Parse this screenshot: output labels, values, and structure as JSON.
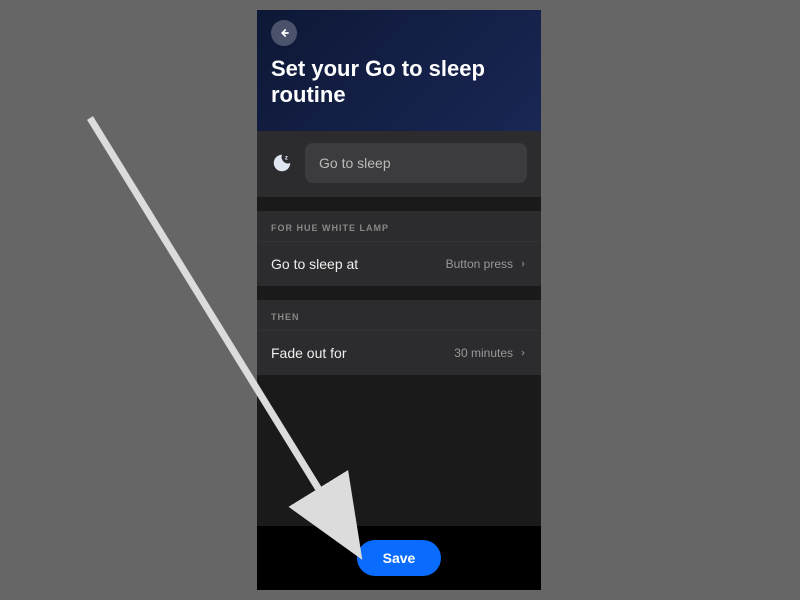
{
  "header": {
    "title": "Set your Go to sleep routine"
  },
  "routine": {
    "name_value": "Go to sleep",
    "icon": "sleep-moon-icon"
  },
  "section1": {
    "header": "FOR HUE WHITE LAMP",
    "row": {
      "label": "Go to sleep at",
      "value": "Button press"
    }
  },
  "section2": {
    "header": "THEN",
    "row": {
      "label": "Fade out for",
      "value": "30 minutes"
    }
  },
  "bottom": {
    "save_label": "Save"
  }
}
